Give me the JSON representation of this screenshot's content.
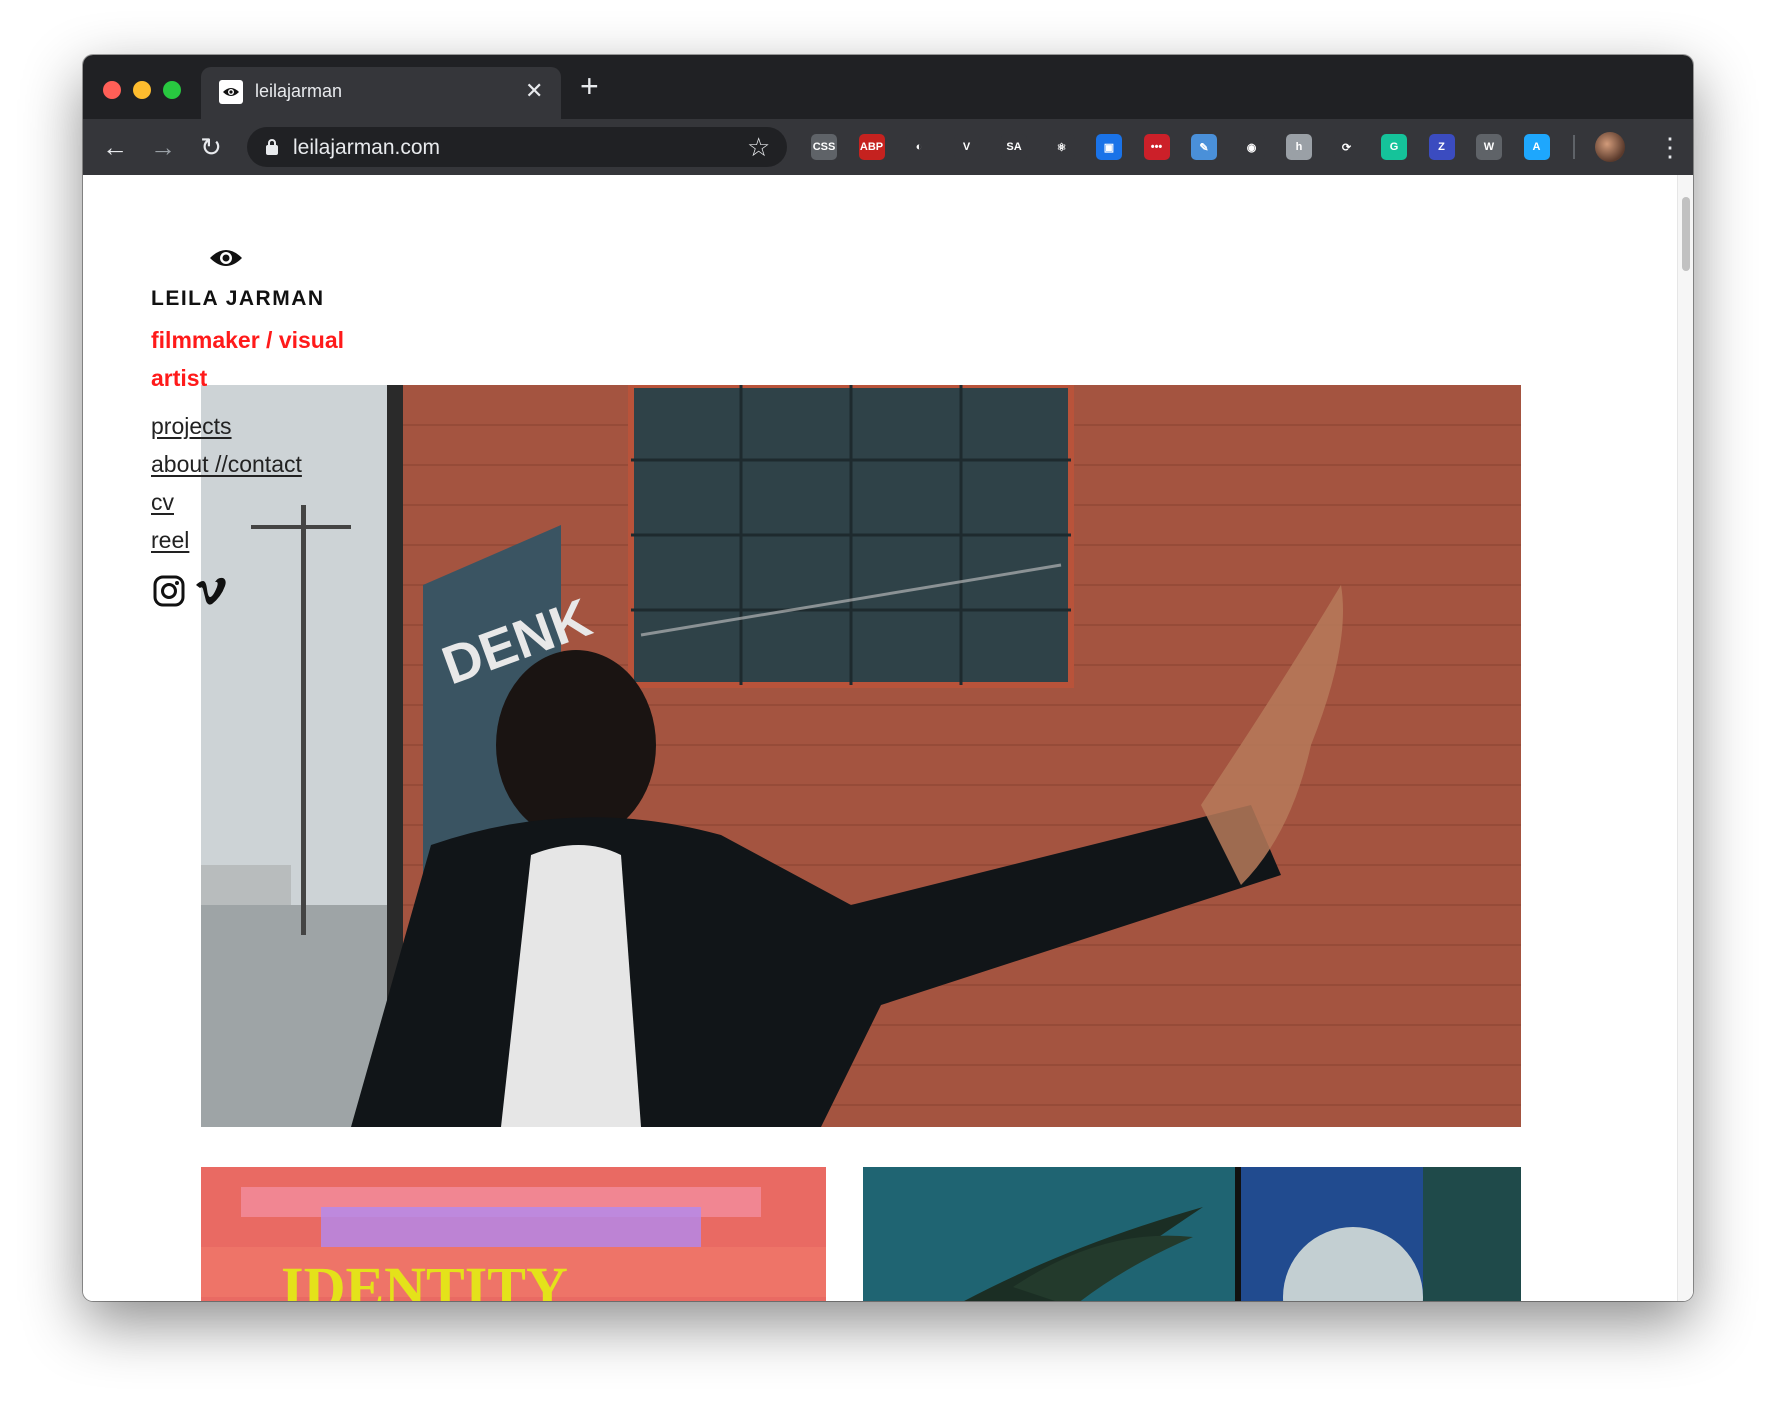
{
  "browser": {
    "tab_title": "leilajarman",
    "close_glyph": "✕",
    "new_tab_glyph": "+",
    "url": "leilajarman.com",
    "back_glyph": "←",
    "forward_glyph": "→",
    "reload_glyph": "↻",
    "star_glyph": "☆",
    "menu_glyph": "⋮",
    "extensions": [
      {
        "name": "css-extension-icon",
        "label": "CSS",
        "color": "#5f6368"
      },
      {
        "name": "adblock-plus-icon",
        "label": "ABP",
        "color": "#c5221f"
      },
      {
        "name": "circle-extension-icon",
        "label": "◐",
        "color": "#35363a"
      },
      {
        "name": "vue-devtools-icon",
        "label": "V",
        "color": "#35363a"
      },
      {
        "name": "sa-extension-icon",
        "label": "SA",
        "color": "#35363a"
      },
      {
        "name": "react-devtools-icon",
        "label": "⚛",
        "color": "#35363a"
      },
      {
        "name": "window-resizer-icon",
        "label": "▣",
        "color": "#1a73e8"
      },
      {
        "name": "lastpass-icon",
        "label": "•••",
        "color": "#cc2029"
      },
      {
        "name": "pen-extension-icon",
        "label": "✎",
        "color": "#4a90d9"
      },
      {
        "name": "tomato-extension-icon",
        "label": "◉",
        "color": "#35363a"
      },
      {
        "name": "h-extension-icon",
        "label": "h",
        "color": "#9aa0a6"
      },
      {
        "name": "refresh-extension-icon",
        "label": "⟳",
        "color": "#35363a"
      },
      {
        "name": "grammarly-icon",
        "label": "G",
        "color": "#15c39a"
      },
      {
        "name": "z-extension-icon",
        "label": "Z",
        "color": "#3b4cc0"
      },
      {
        "name": "w-extension-icon",
        "label": "W",
        "color": "#5f6368"
      },
      {
        "name": "a-extension-icon",
        "label": "A",
        "color": "#1ea7fd"
      }
    ]
  },
  "site": {
    "name": "LEILA JARMAN",
    "tagline": "filmmaker / visual artist",
    "nav": [
      {
        "label": "projects"
      },
      {
        "label": "about //contact"
      },
      {
        "label": "cv"
      },
      {
        "label": "reel"
      }
    ],
    "hero_sign_text": "DENK",
    "tile_left_text": "IDENTITY"
  },
  "colors": {
    "accent": "#ff1a1a",
    "nav_text": "#222222"
  }
}
